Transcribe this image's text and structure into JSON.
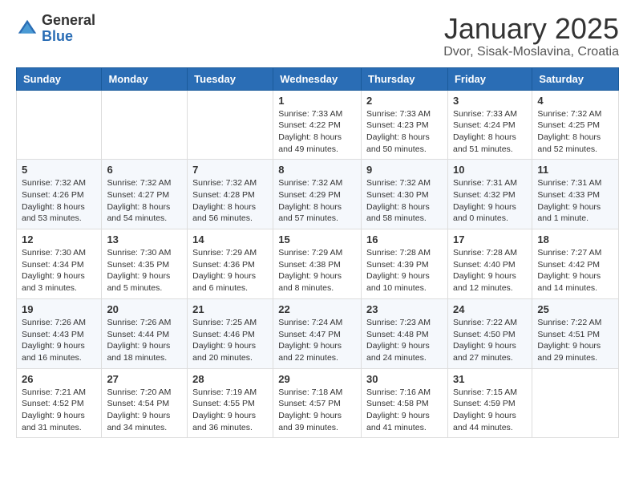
{
  "header": {
    "logo_general": "General",
    "logo_blue": "Blue",
    "month_title": "January 2025",
    "location": "Dvor, Sisak-Moslavina, Croatia"
  },
  "weekdays": [
    "Sunday",
    "Monday",
    "Tuesday",
    "Wednesday",
    "Thursday",
    "Friday",
    "Saturday"
  ],
  "weeks": [
    [
      {
        "day": "",
        "info": ""
      },
      {
        "day": "",
        "info": ""
      },
      {
        "day": "",
        "info": ""
      },
      {
        "day": "1",
        "info": "Sunrise: 7:33 AM\nSunset: 4:22 PM\nDaylight: 8 hours\nand 49 minutes."
      },
      {
        "day": "2",
        "info": "Sunrise: 7:33 AM\nSunset: 4:23 PM\nDaylight: 8 hours\nand 50 minutes."
      },
      {
        "day": "3",
        "info": "Sunrise: 7:33 AM\nSunset: 4:24 PM\nDaylight: 8 hours\nand 51 minutes."
      },
      {
        "day": "4",
        "info": "Sunrise: 7:32 AM\nSunset: 4:25 PM\nDaylight: 8 hours\nand 52 minutes."
      }
    ],
    [
      {
        "day": "5",
        "info": "Sunrise: 7:32 AM\nSunset: 4:26 PM\nDaylight: 8 hours\nand 53 minutes."
      },
      {
        "day": "6",
        "info": "Sunrise: 7:32 AM\nSunset: 4:27 PM\nDaylight: 8 hours\nand 54 minutes."
      },
      {
        "day": "7",
        "info": "Sunrise: 7:32 AM\nSunset: 4:28 PM\nDaylight: 8 hours\nand 56 minutes."
      },
      {
        "day": "8",
        "info": "Sunrise: 7:32 AM\nSunset: 4:29 PM\nDaylight: 8 hours\nand 57 minutes."
      },
      {
        "day": "9",
        "info": "Sunrise: 7:32 AM\nSunset: 4:30 PM\nDaylight: 8 hours\nand 58 minutes."
      },
      {
        "day": "10",
        "info": "Sunrise: 7:31 AM\nSunset: 4:32 PM\nDaylight: 9 hours\nand 0 minutes."
      },
      {
        "day": "11",
        "info": "Sunrise: 7:31 AM\nSunset: 4:33 PM\nDaylight: 9 hours\nand 1 minute."
      }
    ],
    [
      {
        "day": "12",
        "info": "Sunrise: 7:30 AM\nSunset: 4:34 PM\nDaylight: 9 hours\nand 3 minutes."
      },
      {
        "day": "13",
        "info": "Sunrise: 7:30 AM\nSunset: 4:35 PM\nDaylight: 9 hours\nand 5 minutes."
      },
      {
        "day": "14",
        "info": "Sunrise: 7:29 AM\nSunset: 4:36 PM\nDaylight: 9 hours\nand 6 minutes."
      },
      {
        "day": "15",
        "info": "Sunrise: 7:29 AM\nSunset: 4:38 PM\nDaylight: 9 hours\nand 8 minutes."
      },
      {
        "day": "16",
        "info": "Sunrise: 7:28 AM\nSunset: 4:39 PM\nDaylight: 9 hours\nand 10 minutes."
      },
      {
        "day": "17",
        "info": "Sunrise: 7:28 AM\nSunset: 4:40 PM\nDaylight: 9 hours\nand 12 minutes."
      },
      {
        "day": "18",
        "info": "Sunrise: 7:27 AM\nSunset: 4:42 PM\nDaylight: 9 hours\nand 14 minutes."
      }
    ],
    [
      {
        "day": "19",
        "info": "Sunrise: 7:26 AM\nSunset: 4:43 PM\nDaylight: 9 hours\nand 16 minutes."
      },
      {
        "day": "20",
        "info": "Sunrise: 7:26 AM\nSunset: 4:44 PM\nDaylight: 9 hours\nand 18 minutes."
      },
      {
        "day": "21",
        "info": "Sunrise: 7:25 AM\nSunset: 4:46 PM\nDaylight: 9 hours\nand 20 minutes."
      },
      {
        "day": "22",
        "info": "Sunrise: 7:24 AM\nSunset: 4:47 PM\nDaylight: 9 hours\nand 22 minutes."
      },
      {
        "day": "23",
        "info": "Sunrise: 7:23 AM\nSunset: 4:48 PM\nDaylight: 9 hours\nand 24 minutes."
      },
      {
        "day": "24",
        "info": "Sunrise: 7:22 AM\nSunset: 4:50 PM\nDaylight: 9 hours\nand 27 minutes."
      },
      {
        "day": "25",
        "info": "Sunrise: 7:22 AM\nSunset: 4:51 PM\nDaylight: 9 hours\nand 29 minutes."
      }
    ],
    [
      {
        "day": "26",
        "info": "Sunrise: 7:21 AM\nSunset: 4:52 PM\nDaylight: 9 hours\nand 31 minutes."
      },
      {
        "day": "27",
        "info": "Sunrise: 7:20 AM\nSunset: 4:54 PM\nDaylight: 9 hours\nand 34 minutes."
      },
      {
        "day": "28",
        "info": "Sunrise: 7:19 AM\nSunset: 4:55 PM\nDaylight: 9 hours\nand 36 minutes."
      },
      {
        "day": "29",
        "info": "Sunrise: 7:18 AM\nSunset: 4:57 PM\nDaylight: 9 hours\nand 39 minutes."
      },
      {
        "day": "30",
        "info": "Sunrise: 7:16 AM\nSunset: 4:58 PM\nDaylight: 9 hours\nand 41 minutes."
      },
      {
        "day": "31",
        "info": "Sunrise: 7:15 AM\nSunset: 4:59 PM\nDaylight: 9 hours\nand 44 minutes."
      },
      {
        "day": "",
        "info": ""
      }
    ]
  ]
}
